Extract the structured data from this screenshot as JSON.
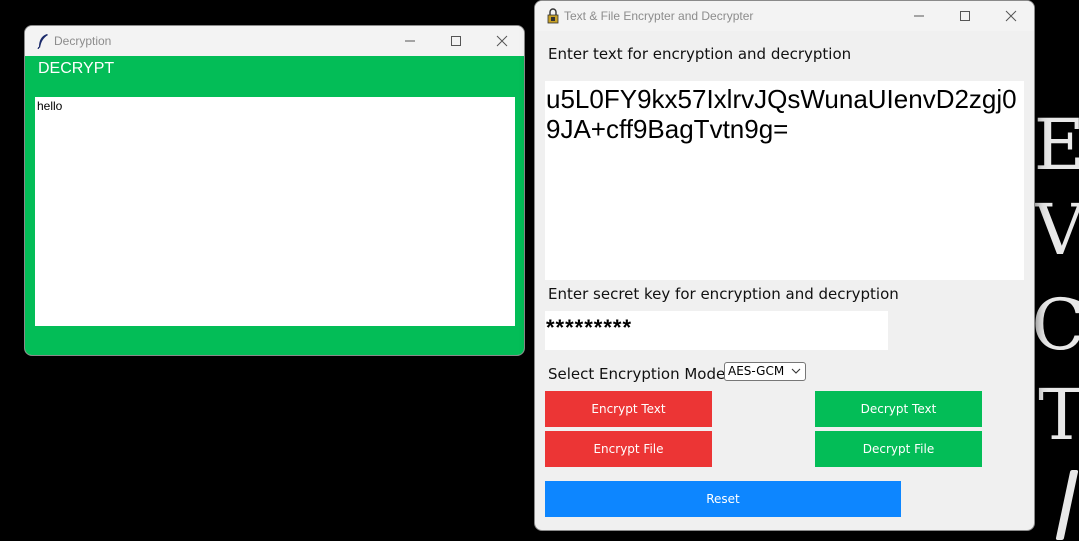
{
  "background": {
    "letters": [
      "E",
      "V",
      "C",
      "T"
    ]
  },
  "decrypt_window": {
    "title": "Decryption",
    "heading": "DECRYPT",
    "result_text": "hello"
  },
  "main_window": {
    "title": "Text & File Encrypter and Decrypter",
    "text_label": "Enter text for encryption and decryption",
    "text_value": "u5L0FY9kx57IxlrvJQsWunaUIenvD2zgj09JA+cff9BagTvtn9g=",
    "key_label": "Enter secret key for encryption and decryption",
    "key_value": "*********",
    "mode_label": "Select Encryption Mode:",
    "mode_value": "AES-GCM",
    "buttons": {
      "encrypt_text": "Encrypt Text",
      "decrypt_text": "Decrypt Text",
      "encrypt_file": "Encrypt File",
      "decrypt_file": "Decrypt File",
      "reset": "Reset"
    }
  },
  "colors": {
    "green": "#03bd57",
    "red": "#ec3535",
    "blue": "#0d86ff",
    "desktop": "#000000"
  }
}
